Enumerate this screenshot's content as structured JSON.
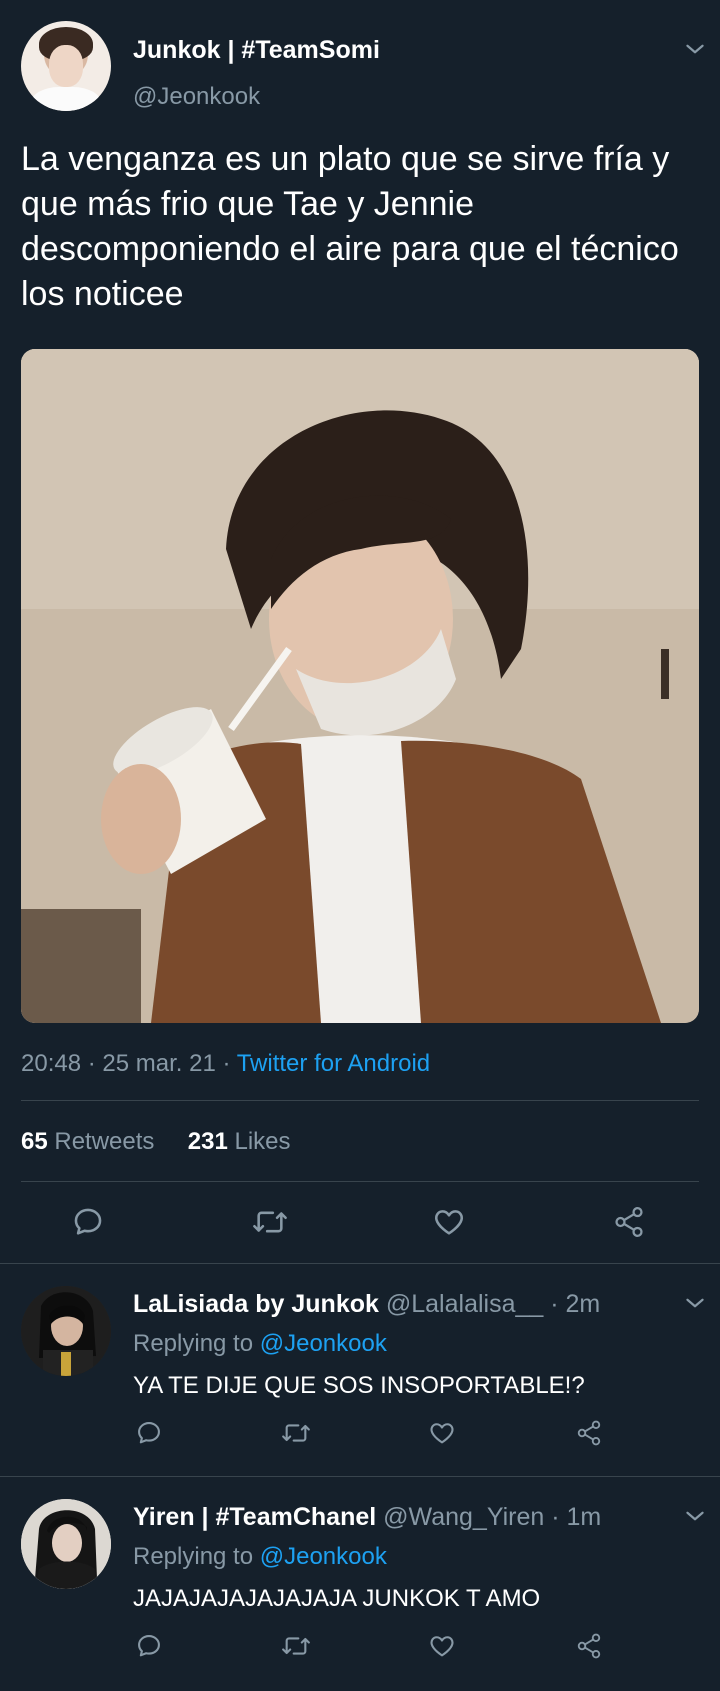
{
  "tweet": {
    "author_name": "Junkok | #TeamSomi",
    "author_handle": "@Jeonkook",
    "text": "La venganza es un plato que se sirve fría y que más frio que Tae y Jennie descomponiendo el aire para que el técnico los noticee",
    "time": "20:48",
    "date": "25 mar. 21",
    "source": "Twitter for Android",
    "retweets_count": "65",
    "retweets_label": "Retweets",
    "likes_count": "231",
    "likes_label": "Likes"
  },
  "replies": [
    {
      "name": "LaLisiada by Junkok",
      "handle": "@Lalalalisa__",
      "age": "· 2m",
      "replying_label": "Replying to",
      "replying_handle": "@Jeonkook",
      "text": "YA TE DIJE QUE SOS INSOPORTABLE!?"
    },
    {
      "name": "Yiren | #TeamChanel",
      "handle": "@Wang_Yiren",
      "age": "· 1m",
      "replying_label": "Replying to",
      "replying_handle": "@Jeonkook",
      "text": "JAJAJAJAJAJAJAJA JUNKOK T AMO"
    }
  ],
  "icons": {
    "reply": "reply-icon",
    "retweet": "retweet-icon",
    "like": "heart-icon",
    "share": "share-icon",
    "menu": "chevron-down-icon"
  },
  "colors": {
    "background": "#15202b",
    "text": "#ffffff",
    "muted": "#8899a6",
    "link": "#1da1f2",
    "divider": "#38444d"
  }
}
